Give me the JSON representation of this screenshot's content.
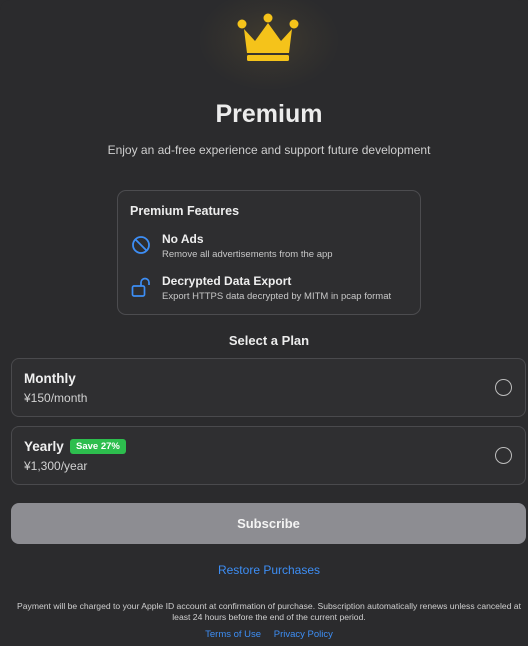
{
  "header": {
    "title": "Premium",
    "subtitle": "Enjoy an ad-free experience and support future development",
    "icon": "crown-icon",
    "accent_color": "#f5c31a"
  },
  "features": {
    "title": "Premium Features",
    "items": [
      {
        "icon": "no-symbol-icon",
        "name": "No Ads",
        "description": "Remove all advertisements from the app"
      },
      {
        "icon": "unlock-icon",
        "name": "Decrypted Data Export",
        "description": "Export HTTPS data decrypted by MITM in pcap format"
      }
    ]
  },
  "plans": {
    "title": "Select a Plan",
    "options": [
      {
        "name": "Monthly",
        "price": "¥150/month",
        "selected": false
      },
      {
        "name": "Yearly",
        "price": "¥1,300/year",
        "badge": "Save 27%",
        "selected": false
      }
    ]
  },
  "actions": {
    "subscribe_label": "Subscribe",
    "restore_label": "Restore Purchases",
    "link_color": "#3d8ef5"
  },
  "footer": {
    "legal": "Payment will be charged to your Apple ID account at confirmation of purchase. Subscription automatically renews unless canceled at least 24 hours before the end of the current period.",
    "terms_label": "Terms of Use",
    "privacy_label": "Privacy Policy"
  }
}
